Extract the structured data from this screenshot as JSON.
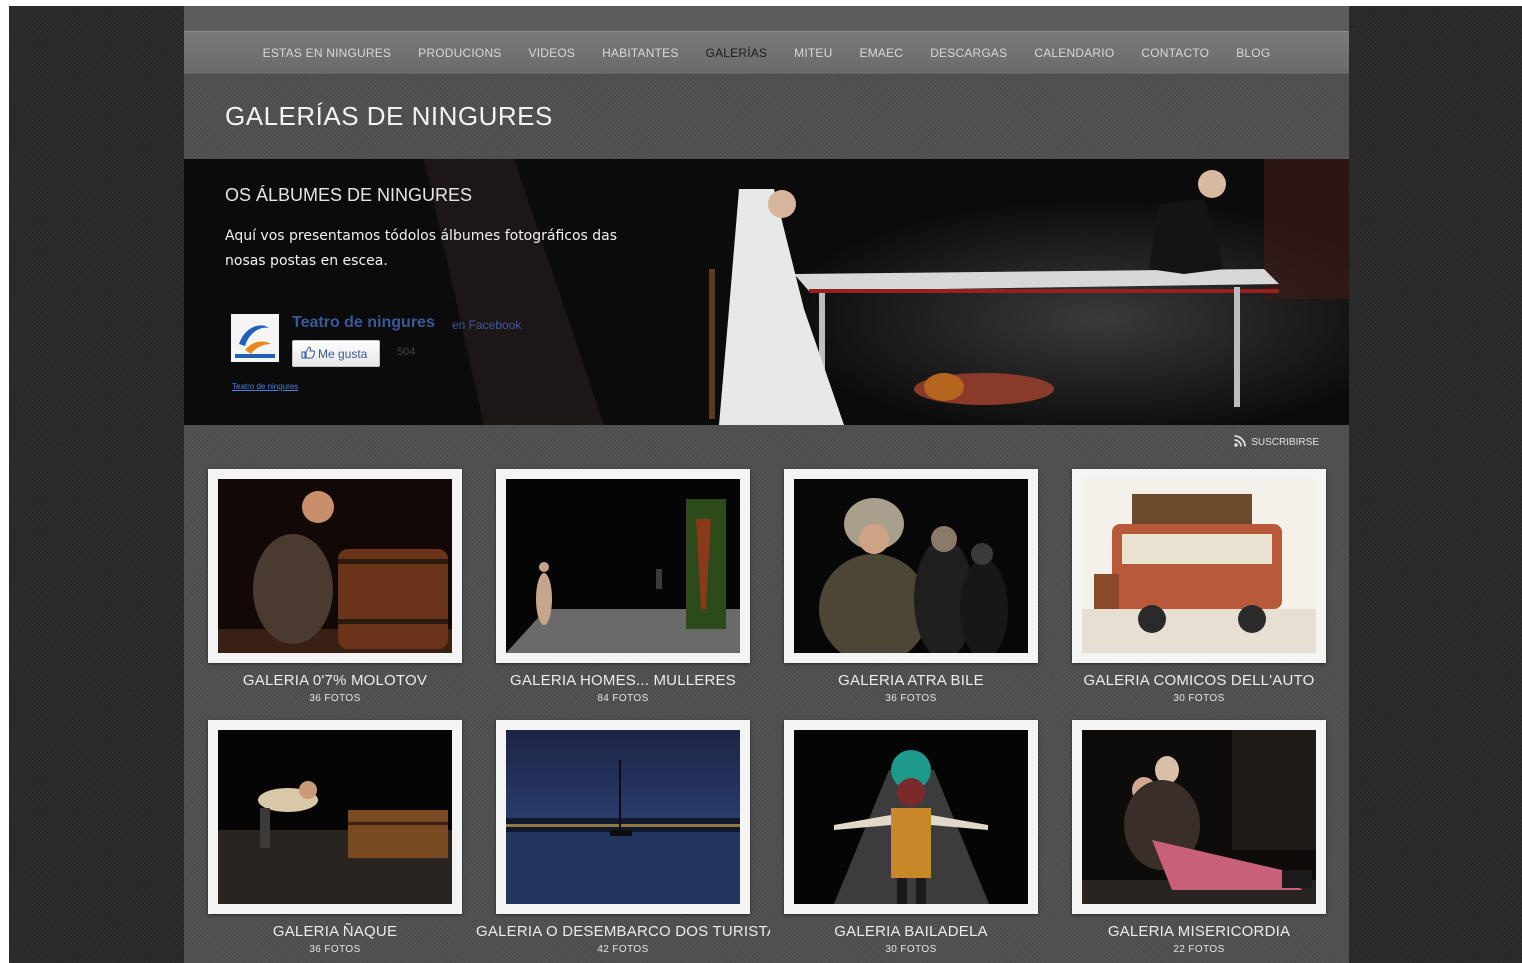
{
  "nav": {
    "items": [
      {
        "label": "ESTAS EN NINGURES"
      },
      {
        "label": "PRODUCIONS"
      },
      {
        "label": "VIDEOS"
      },
      {
        "label": "HABITANTES"
      },
      {
        "label": "GALERÍAS"
      },
      {
        "label": "MITEU"
      },
      {
        "label": "EMAEC"
      },
      {
        "label": "DESCARGAS"
      },
      {
        "label": "CALENDARIO"
      },
      {
        "label": "CONTACTO"
      },
      {
        "label": "BLOG"
      }
    ],
    "active": "GALERÍAS",
    "active_color": "#1a1a1a"
  },
  "page": {
    "title": "GALERÍAS DE NINGURES"
  },
  "hero": {
    "heading": "OS ÁLBUMES DE NINGURES",
    "text": "Aquí vos presentamos tódolos álbumes fotográficos das nosas postas en escea."
  },
  "facebook": {
    "page_name": "Teatro de ningures",
    "on_facebook": "en Facebook",
    "like_label": "Me gusta",
    "like_count": "504",
    "link_text": "Teatro de ningures",
    "brand_color": "#3b5998"
  },
  "subscribe": {
    "label": "SUSCRIBIRSE",
    "icon": "rss-icon"
  },
  "galleries": [
    {
      "title": "GALERIA 0'7% MOLOTOV",
      "count": "36 FOTOS"
    },
    {
      "title": "GALERIA HOMES... MULLERES",
      "count": "84 FOTOS"
    },
    {
      "title": "GALERIA ATRA BILE",
      "count": "36 FOTOS"
    },
    {
      "title": "GALERIA COMICOS DELL'AUTO",
      "count": "30 FOTOS"
    },
    {
      "title": "GALERIA ÑAQUE",
      "count": "36 FOTOS"
    },
    {
      "title": "GALERIA O DESEMBARCO DOS TURISTAS",
      "count": "42 FOTOS"
    },
    {
      "title": "GALERIA BAILADELA",
      "count": "30 FOTOS"
    },
    {
      "title": "GALERIA MISERICORDIA",
      "count": "22 FOTOS"
    }
  ]
}
